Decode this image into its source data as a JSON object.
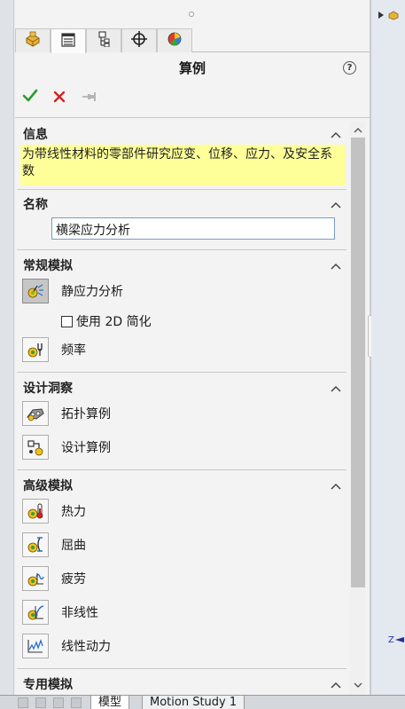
{
  "header": {
    "title": "算例",
    "help_label": "?"
  },
  "tabs": [
    {
      "name": "feature-manager"
    },
    {
      "name": "property-manager"
    },
    {
      "name": "configuration-manager"
    },
    {
      "name": "dimxpert-manager"
    },
    {
      "name": "display-manager"
    }
  ],
  "sections": {
    "info": {
      "title": "信息",
      "text": "为带线性材料的零部件研究应变、位移、应力、及安全系数"
    },
    "name": {
      "title": "名称",
      "value": "横梁应力分析"
    },
    "general": {
      "title": "常规模拟",
      "items": [
        "静应力分析",
        "频率"
      ],
      "option_2d": "使用 2D 简化"
    },
    "design": {
      "title": "设计洞察",
      "items": [
        "拓扑算例",
        "设计算例"
      ]
    },
    "advanced": {
      "title": "高级模拟",
      "items": [
        "热力",
        "屈曲",
        "疲劳",
        "非线性",
        "线性动力"
      ]
    },
    "special": {
      "title": "专用模拟"
    }
  },
  "viewport": {
    "axis_label": "Z"
  },
  "bottom_tabs": [
    "模型",
    "Motion Study 1"
  ],
  "colors": {
    "ok_green": "#2e9a2e",
    "cancel_red": "#d62222",
    "info_highlight": "#ffff99"
  }
}
